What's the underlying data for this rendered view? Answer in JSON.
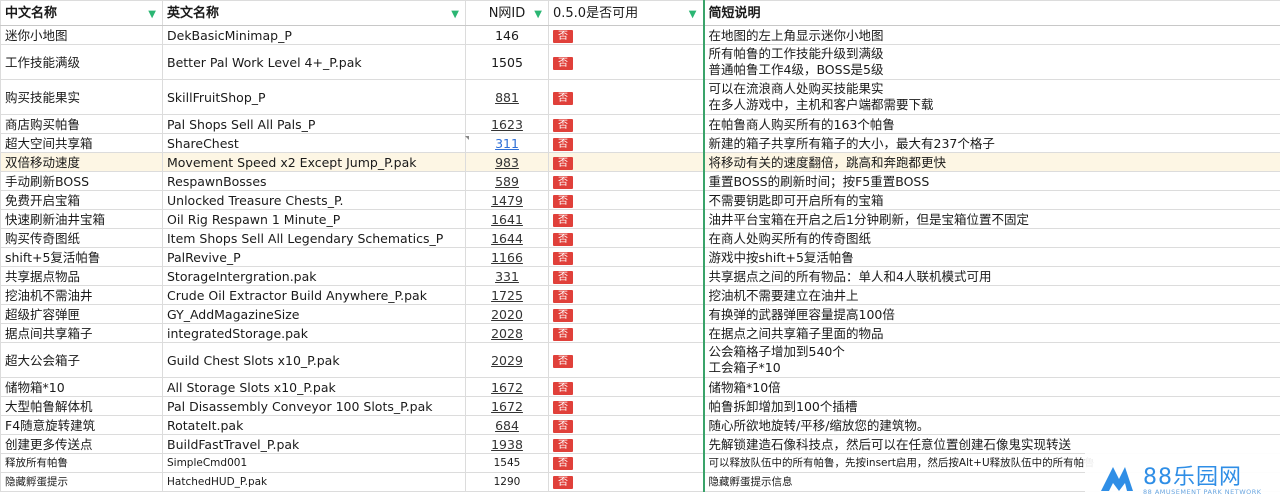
{
  "headers": [
    "中文名称",
    "英文名称",
    "N网ID",
    "0.5.0是否可用",
    "简短说明"
  ],
  "badge_label": "否",
  "rows": [
    {
      "cn": "迷你小地图",
      "en": "DekBasicMinimap_P",
      "id": "146",
      "desc": [
        "在地图的左上角显示迷你小地图"
      ]
    },
    {
      "cn": "工作技能满级",
      "en": "Better Pal Work Level 4+_P.pak",
      "id": "1505",
      "desc": [
        "所有帕鲁的工作技能升级到满级",
        "普通帕鲁工作4级，BOSS是5级"
      ]
    },
    {
      "cn": "购买技能果实",
      "en": "SkillFruitShop_P",
      "id": "881",
      "desc": [
        "可以在流浪商人处购买技能果实",
        "在多人游戏中，主机和客户端都需要下载"
      ]
    },
    {
      "cn": "商店购买帕鲁",
      "en": "Pal Shops Sell All Pals_P",
      "id": "1623",
      "desc": [
        "在帕鲁商人购买所有的163个帕鲁"
      ]
    },
    {
      "cn": "超大空间共享箱",
      "en": "ShareChest",
      "id": "311",
      "desc": [
        "新建的箱子共享所有箱子的大小，最大有237个格子"
      ]
    },
    {
      "cn": "双倍移动速度",
      "en": "Movement Speed x2 Except Jump_P.pak",
      "id": "983",
      "desc": [
        "将移动有关的速度翻倍，跳高和奔跑都更快"
      ]
    },
    {
      "cn": "手动刷新BOSS",
      "en": "RespawnBosses",
      "id": "589",
      "desc": [
        "重置BOSS的刷新时间；按F5重置BOSS"
      ]
    },
    {
      "cn": "免费开启宝箱",
      "en": "Unlocked Treasure Chests_P.",
      "id": "1479",
      "desc": [
        "不需要钥匙即可开启所有的宝箱"
      ]
    },
    {
      "cn": "快速刷新油井宝箱",
      "en": "Oil Rig Respawn 1 Minute_P",
      "id": "1641",
      "desc": [
        "油井平台宝箱在开启之后1分钟刷新，但是宝箱位置不固定"
      ]
    },
    {
      "cn": "购买传奇图纸",
      "en": "Item Shops Sell All Legendary Schematics_P",
      "id": "1644",
      "desc": [
        "在商人处购买所有的传奇图纸"
      ]
    },
    {
      "cn": "shift+5复活帕鲁",
      "en": "PalRevive_P",
      "id": "1166",
      "desc": [
        "游戏中按shift+5复活帕鲁"
      ]
    },
    {
      "cn": "共享据点物品",
      "en": "StorageIntergration.pak",
      "id": "331",
      "desc": [
        "共享据点之间的所有物品：单人和4人联机模式可用"
      ]
    },
    {
      "cn": "挖油机不需油井",
      "en": "Crude Oil Extractor Build Anywhere_P.pak",
      "id": "1725",
      "desc": [
        "挖油机不需要建立在油井上"
      ]
    },
    {
      "cn": "超级扩容弹匣",
      "en": "GY_AddMagazineSize",
      "id": "2020",
      "desc": [
        "有换弹的武器弹匣容量提高100倍"
      ]
    },
    {
      "cn": "据点间共享箱子",
      "en": "integratedStorage.pak",
      "id": "2028",
      "desc": [
        "在据点之间共享箱子里面的物品"
      ]
    },
    {
      "cn": "超大公会箱子",
      "en": "Guild Chest Slots x10_P.pak",
      "id": "2029",
      "desc": [
        "公会箱格子增加到540个",
        "工会箱子*10"
      ]
    },
    {
      "cn": "储物箱*10",
      "en": "All Storage Slots x10_P.pak",
      "id": "1672",
      "desc": [
        "储物箱*10倍"
      ]
    },
    {
      "cn": "大型帕鲁解体机",
      "en": "Pal Disassembly Conveyor 100 Slots_P.pak",
      "id": "1672",
      "desc": [
        "帕鲁拆卸增加到100个插槽"
      ]
    },
    {
      "cn": "F4随意旋转建筑",
      "en": "RotateIt.pak",
      "id": "684",
      "desc": [
        "随心所欲地旋转/平移/缩放您的建筑物。"
      ]
    },
    {
      "cn": "创建更多传送点",
      "en": "BuildFastTravel_P.pak",
      "id": "1938",
      "desc": [
        "先解锁建造石像科技点，然后可以在任意位置创建石像鬼实现转送"
      ]
    },
    {
      "cn": "释放所有帕鲁",
      "en": "SimpleCmd001",
      "id": "1545",
      "desc": [
        "可以释放队伍中的所有帕鲁，先按insert启用，然后按Alt+U释放队伍中的所有帕鲁"
      ]
    },
    {
      "cn": "隐藏孵蛋提示",
      "en": "HatchedHUD_P.pak",
      "id": "1290",
      "desc": [
        "隐藏孵蛋提示信息"
      ]
    }
  ],
  "watermark": {
    "name": "88乐园网",
    "sub": "88 AMUSEMENT PARK NETWORK",
    "color": "#2f8ee6"
  },
  "colors": {
    "badge": "#e0403a",
    "filter": "#2bb673",
    "highlight_row": "#fdf6e4",
    "link_blue": "#2f6fd6"
  }
}
